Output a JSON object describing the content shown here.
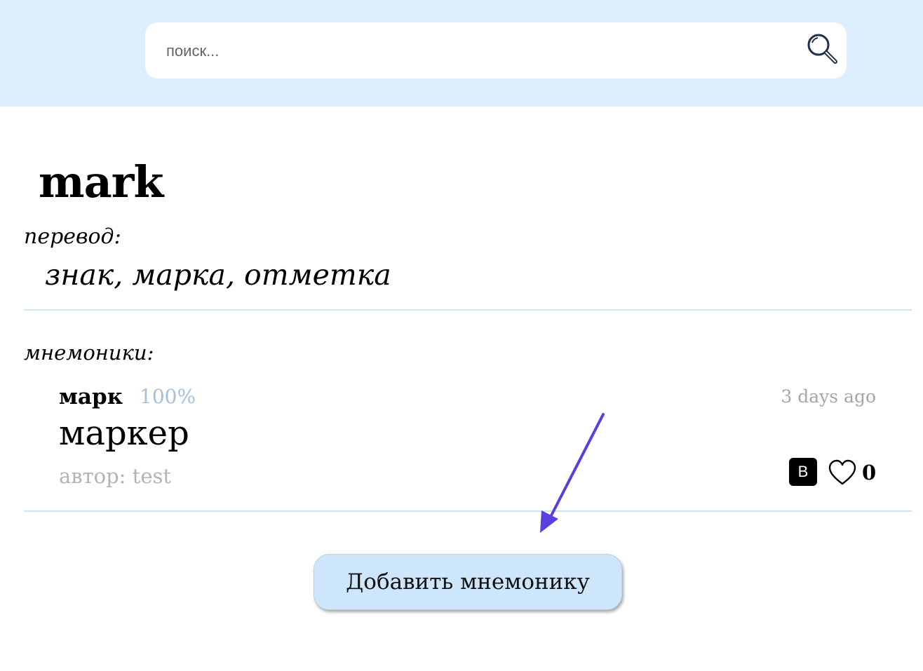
{
  "search": {
    "placeholder": "поиск..."
  },
  "word": {
    "title": "mark",
    "translation_label": "перевод:",
    "translation": "знак, марка, отметка"
  },
  "mnemonics": {
    "label": "мнемоники:",
    "items": [
      {
        "key": "марк",
        "percent": "100%",
        "date": "3 days ago",
        "text": "маркер",
        "author": "автор: test",
        "badge": "B",
        "likes": "0"
      }
    ]
  },
  "actions": {
    "add_mnemonic": "Добавить мнемонику"
  },
  "colors": {
    "header_bg": "#dfeefd",
    "button_bg": "#cde6fc",
    "percent": "#a7bfd8",
    "arrow": "#5a3fe0"
  },
  "icons": [
    "search-icon",
    "heart-icon",
    "arrow-annotation-icon"
  ]
}
